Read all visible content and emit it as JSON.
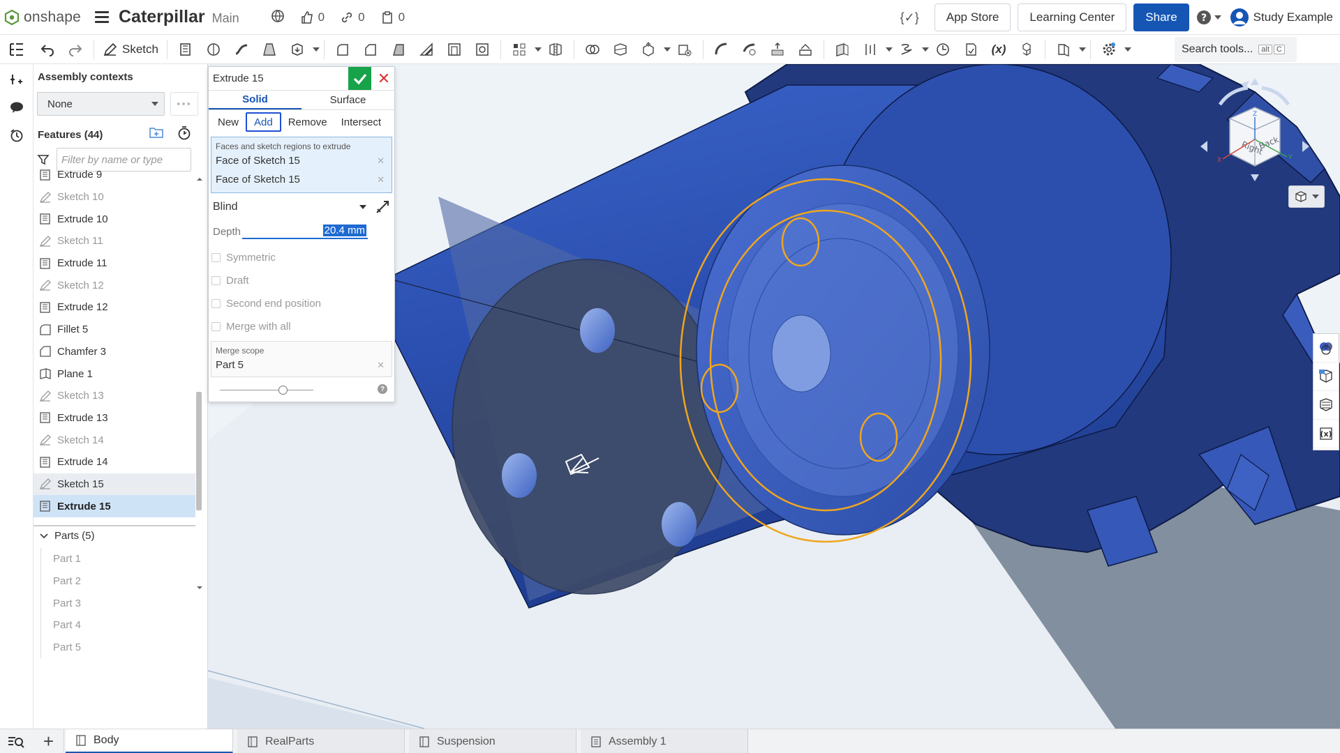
{
  "app": {
    "logo_text": "onshape",
    "doc_title": "Caterpillar",
    "branch": "Main",
    "likes": "0",
    "links": "0",
    "copies": "0",
    "app_store": "App Store",
    "learning_center": "Learning Center",
    "share": "Share",
    "user": "Study Example",
    "fx_label": "{✓}"
  },
  "toolbar": {
    "sketch_label": "Sketch",
    "search_placeholder": "Search tools...",
    "search_kbd1": "alt",
    "search_kbd2": "C"
  },
  "features_panel": {
    "assembly_contexts_label": "Assembly contexts",
    "assembly_select_value": "None",
    "features_label": "Features (44)",
    "filter_placeholder": "Filter by name or type",
    "items": [
      {
        "label": "Extrude 9",
        "type": "extrude",
        "state": "normal"
      },
      {
        "label": "Sketch 10",
        "type": "sketch",
        "state": "normal"
      },
      {
        "label": "Extrude 10",
        "type": "extrude",
        "state": "normal"
      },
      {
        "label": "Sketch 11",
        "type": "sketch",
        "state": "normal"
      },
      {
        "label": "Extrude 11",
        "type": "extrude",
        "state": "normal"
      },
      {
        "label": "Sketch 12",
        "type": "sketch",
        "state": "normal"
      },
      {
        "label": "Extrude 12",
        "type": "extrude",
        "state": "normal"
      },
      {
        "label": "Fillet 5",
        "type": "fillet",
        "state": "normal"
      },
      {
        "label": "Chamfer 3",
        "type": "chamfer",
        "state": "normal"
      },
      {
        "label": "Plane 1",
        "type": "plane",
        "state": "normal"
      },
      {
        "label": "Sketch 13",
        "type": "sketch",
        "state": "normal"
      },
      {
        "label": "Extrude 13",
        "type": "extrude",
        "state": "normal"
      },
      {
        "label": "Sketch 14",
        "type": "sketch",
        "state": "normal"
      },
      {
        "label": "Extrude 14",
        "type": "extrude",
        "state": "normal"
      },
      {
        "label": "Sketch 15",
        "type": "sketch",
        "state": "highlight"
      },
      {
        "label": "Extrude 15",
        "type": "extrude",
        "state": "selected"
      }
    ],
    "parts_label": "Parts (5)",
    "parts": [
      "Part 1",
      "Part 2",
      "Part 3",
      "Part 4",
      "Part 5"
    ]
  },
  "dialog": {
    "title": "Extrude 15",
    "tabs": [
      "Solid",
      "Surface"
    ],
    "active_tab": "Solid",
    "operations": [
      "New",
      "Add",
      "Remove",
      "Intersect"
    ],
    "active_operation": "Add",
    "selection_label": "Faces and sketch regions to extrude",
    "selections": [
      "Face of Sketch 15",
      "Face of Sketch 15"
    ],
    "end_type": "Blind",
    "depth_label": "Depth",
    "depth_value": "20.4 mm",
    "checkboxes": [
      "Symmetric",
      "Draft",
      "Second end position",
      "Merge with all"
    ],
    "merge_scope_label": "Merge scope",
    "merge_scope_value": "Part 5"
  },
  "viewcube": {
    "face_right": "Right",
    "face_back": "Back",
    "axis_z": "Z",
    "axis_x": "X",
    "axis_y": "Y"
  },
  "bottom_tabs": [
    {
      "label": "Body",
      "active": true
    },
    {
      "label": "RealParts",
      "active": false
    },
    {
      "label": "Suspension",
      "active": false
    },
    {
      "label": "Assembly 1",
      "active": false
    }
  ],
  "colors": {
    "accent": "#1556b5",
    "ok_green": "#17a34a",
    "part_blue": "#2a4da3",
    "selection_orange": "#f0a51e"
  }
}
